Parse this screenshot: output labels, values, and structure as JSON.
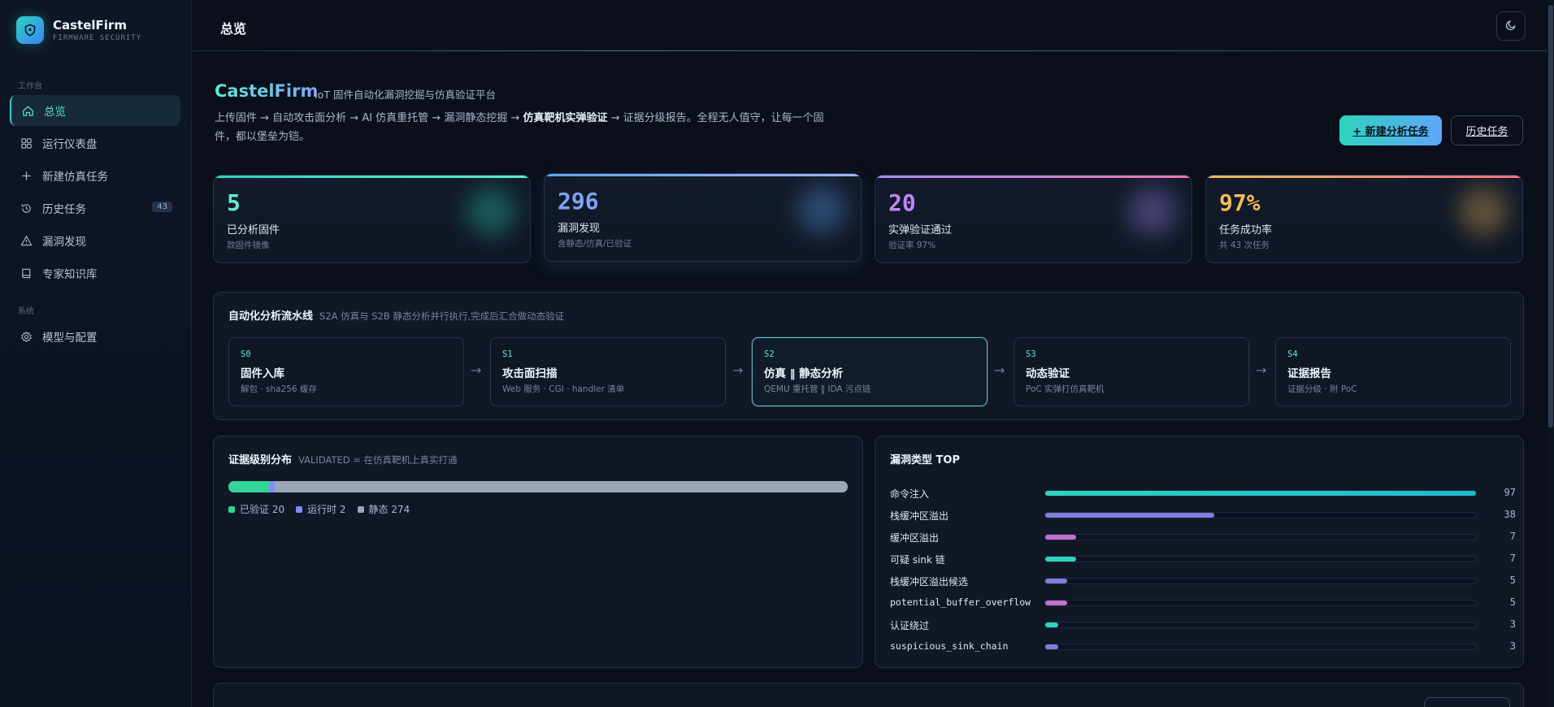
{
  "brand": {
    "name": "CastelFirm",
    "subtitle": "FIRMWARE SECURITY"
  },
  "sidebar": {
    "section_workspace": "工作台",
    "section_system": "系统",
    "items": [
      {
        "label": "总览",
        "icon": "home-icon",
        "active": true
      },
      {
        "label": "运行仪表盘",
        "icon": "dashboard-icon"
      },
      {
        "label": "新建仿真任务",
        "icon": "plus-icon"
      },
      {
        "label": "历史任务",
        "icon": "history-icon",
        "badge": "43"
      },
      {
        "label": "漏洞发现",
        "icon": "warning-icon"
      },
      {
        "label": "专家知识库",
        "icon": "book-icon"
      },
      {
        "label": "模型与配置",
        "icon": "gear-icon"
      }
    ]
  },
  "header": {
    "title": "总览",
    "theme_icon": "moon-icon"
  },
  "hero": {
    "title": "CastelFirm",
    "subtitle": "IoT 固件自动化漏洞挖掘与仿真验证平台",
    "desc_before": "上传固件 → 自动攻击面分析 → AI 仿真重托管 → 漏洞静态挖掘 → ",
    "desc_bold": "仿真靶机实弹验证",
    "desc_after": " → 证据分级报告。全程无人值守，让每一个固件，都以堡垒为铠。",
    "new_task_label": "+ 新建分析任务",
    "history_label": "历史任务"
  },
  "stats": [
    {
      "value": "5",
      "label": "已分析固件",
      "sub": "款固件镜像",
      "color": "#5eead4"
    },
    {
      "value": "296",
      "label": "漏洞发现",
      "sub": "含静态/仿真/已验证",
      "color": "#7ca4f8"
    },
    {
      "value": "20",
      "label": "实弹验证通过",
      "sub": "验证率 97%",
      "color": "#c084fc"
    },
    {
      "value": "97%",
      "label": "任务成功率",
      "sub": "共 43 次任务",
      "color": "#f5b95c"
    }
  ],
  "pipeline": {
    "title": "自动化分析流水线",
    "subtitle": "S2A 仿真与 S2B 静态分析并行执行,完成后汇合做动态验证",
    "stages": [
      {
        "code": "S0",
        "name": "固件入库",
        "desc": "解包 · sha256 缓存"
      },
      {
        "code": "S1",
        "name": "攻击面扫描",
        "desc": "Web 服务 · CGI · handler 清单"
      },
      {
        "code": "S2",
        "name": "仿真 ‖ 静态分析",
        "desc": "QEMU 重托管 ‖ IDA 污点链",
        "active": true
      },
      {
        "code": "S3",
        "name": "动态验证",
        "desc": "PoC 实弹打仿真靶机"
      },
      {
        "code": "S4",
        "name": "证据报告",
        "desc": "证据分级 · 附 PoC"
      }
    ],
    "arrow": "→"
  },
  "evidence": {
    "title": "证据级别分布",
    "subtitle": "VALIDATED = 在仿真靶机上真实打通",
    "segments": [
      {
        "label": "已验证",
        "value": 20,
        "color": "#34d399"
      },
      {
        "label": "运行时",
        "value": 2,
        "color": "#818cf8"
      },
      {
        "label": "静态",
        "value": 274,
        "color": "#9aa5b6"
      }
    ],
    "legend": [
      "已验证 20",
      "运行时 2",
      "静态 274"
    ]
  },
  "vuln_types": {
    "title": "漏洞类型 TOP",
    "max": 97,
    "rows": [
      {
        "name": "命令注入",
        "count": 97,
        "color": "#2dd4bf",
        "mono": false
      },
      {
        "name": "栈缓冲区溢出",
        "count": 38,
        "color": "#7c7fe0",
        "mono": false
      },
      {
        "name": "缓冲区溢出",
        "count": 7,
        "color": "#c26fcf",
        "mono": false
      },
      {
        "name": "可疑 sink 链",
        "count": 7,
        "color": "#2dd4bf",
        "mono": false
      },
      {
        "name": "栈缓冲区溢出候选",
        "count": 5,
        "color": "#7c7fe0",
        "mono": false
      },
      {
        "name": "potential_buffer_overflow",
        "count": 5,
        "color": "#c26fcf",
        "mono": true
      },
      {
        "name": "认证绕过",
        "count": 3,
        "color": "#2dd4bf",
        "mono": false
      },
      {
        "name": "suspicious_sink_chain",
        "count": 3,
        "color": "#7c7fe0",
        "mono": true
      }
    ]
  }
}
